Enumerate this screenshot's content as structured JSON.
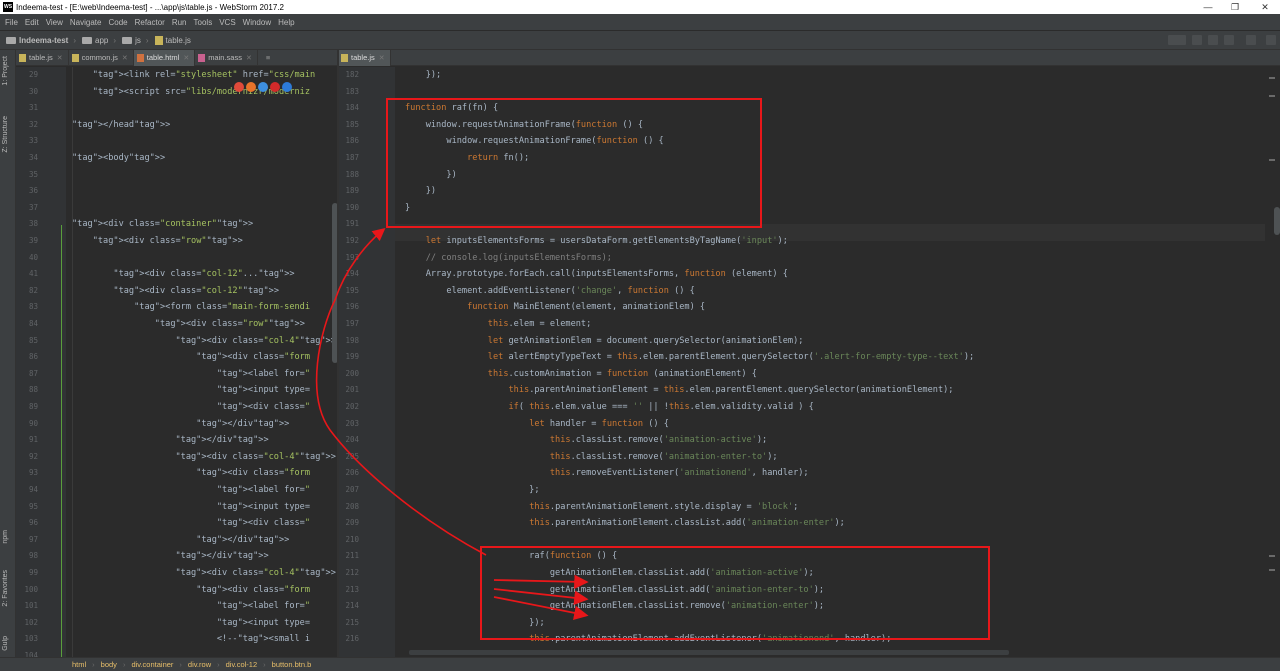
{
  "title": "Indeema-test - [E:\\web\\Indeema-test] - ...\\app\\js\\table.js - WebStorm 2017.2",
  "app_logo": "WS",
  "window_controls": [
    "—",
    "❐",
    "✕"
  ],
  "menu": [
    "File",
    "Edit",
    "View",
    "Navigate",
    "Code",
    "Refactor",
    "Run",
    "Tools",
    "VCS",
    "Window",
    "Help"
  ],
  "breadcrumbs": [
    "Indeema-test",
    "app",
    "js",
    "table.js"
  ],
  "left_tabs": [
    {
      "label": "table.js",
      "icon": "js-file-icon",
      "active": false
    },
    {
      "label": "common.js",
      "icon": "js-file-icon",
      "active": false
    },
    {
      "label": "table.html",
      "icon": "html-file-icon",
      "active": true
    },
    {
      "label": "main.sass",
      "icon": "sass-file-icon",
      "active": false
    }
  ],
  "left_tab_overflow": "≡",
  "right_tabs": [
    {
      "label": "table.js",
      "icon": "js-file-icon",
      "active": true
    }
  ],
  "toolwindows": {
    "project": "1: Project",
    "structure": "Z: Structure",
    "npm": "npm",
    "favorites": "2: Favorites",
    "gulp": "Gulp"
  },
  "browser_icons": [
    "chrome-icon",
    "firefox-icon",
    "safari-icon",
    "opera-icon",
    "ie-icon"
  ],
  "left_editor": {
    "lines": [
      {
        "n": "29",
        "text": "    <link rel=\"stylesheet\" href=\"css/main"
      },
      {
        "n": "30",
        "text": "    <script src=\"libs/modernizr/moderniz"
      },
      {
        "n": "31",
        "text": ""
      },
      {
        "n": "32",
        "text": "</head>"
      },
      {
        "n": "33",
        "text": ""
      },
      {
        "n": "34",
        "text": "<body>"
      },
      {
        "n": "35",
        "text": ""
      },
      {
        "n": "36",
        "text": ""
      },
      {
        "n": "37",
        "text": ""
      },
      {
        "n": "38",
        "text": "<div class=\"container\">"
      },
      {
        "n": "39",
        "text": "    <div class=\"row\">"
      },
      {
        "n": "40",
        "text": ""
      },
      {
        "n": "41",
        "text": "        <div class=\"col-12\"...>"
      },
      {
        "n": "82",
        "text": "        <div class=\"col-12\">"
      },
      {
        "n": "83",
        "text": "            <form class=\"main-form-sendi"
      },
      {
        "n": "84",
        "text": "                <div class=\"row\">"
      },
      {
        "n": "85",
        "text": "                    <div class=\"col-4\">"
      },
      {
        "n": "86",
        "text": "                        <div class=\"form"
      },
      {
        "n": "87",
        "text": "                            <label for=\""
      },
      {
        "n": "88",
        "text": "                            <input type="
      },
      {
        "n": "89",
        "text": "                            <div class=\""
      },
      {
        "n": "90",
        "text": "                        </div>"
      },
      {
        "n": "91",
        "text": "                    </div>"
      },
      {
        "n": "92",
        "text": "                    <div class=\"col-4\">"
      },
      {
        "n": "93",
        "text": "                        <div class=\"form"
      },
      {
        "n": "94",
        "text": "                            <label for=\""
      },
      {
        "n": "95",
        "text": "                            <input type="
      },
      {
        "n": "96",
        "text": "                            <div class=\""
      },
      {
        "n": "97",
        "text": "                        </div>"
      },
      {
        "n": "98",
        "text": "                    </div>"
      },
      {
        "n": "99",
        "text": "                    <div class=\"col-4\">"
      },
      {
        "n": "100",
        "text": "                        <div class=\"form"
      },
      {
        "n": "101",
        "text": "                            <label for=\""
      },
      {
        "n": "102",
        "text": "                            <input type="
      },
      {
        "n": "103",
        "text": "                            <!--<small i"
      },
      {
        "n": "104",
        "text": ""
      }
    ]
  },
  "right_editor": {
    "lines": [
      {
        "n": "182",
        "text": "    });"
      },
      {
        "n": "183",
        "text": ""
      },
      {
        "n": "184",
        "text": "function raf(fn) {"
      },
      {
        "n": "185",
        "text": "    window.requestAnimationFrame(function () {"
      },
      {
        "n": "186",
        "text": "        window.requestAnimationFrame(function () {"
      },
      {
        "n": "187",
        "text": "            return fn();"
      },
      {
        "n": "188",
        "text": "        })"
      },
      {
        "n": "189",
        "text": "    })"
      },
      {
        "n": "190",
        "text": "}"
      },
      {
        "n": "191",
        "text": ""
      },
      {
        "n": "192",
        "text": "    let inputsElementsForms = usersDataForm.getElementsByTagName('input');"
      },
      {
        "n": "193",
        "text": "    // console.log(inputsElementsForms);"
      },
      {
        "n": "194",
        "text": "    Array.prototype.forEach.call(inputsElementsForms, function (element) {"
      },
      {
        "n": "195",
        "text": "        element.addEventListener('change', function () {"
      },
      {
        "n": "196",
        "text": "            function MainElement(element, animationElem) {"
      },
      {
        "n": "197",
        "text": "                this.elem = element;"
      },
      {
        "n": "198",
        "text": "                let getAnimationElem = document.querySelector(animationElem);"
      },
      {
        "n": "199",
        "text": "                let alertEmptyTypeText = this.elem.parentElement.querySelector('.alert-for-empty-type--text');"
      },
      {
        "n": "200",
        "text": "                this.customAnimation = function (animationElement) {"
      },
      {
        "n": "201",
        "text": "                    this.parentAnimationElement = this.elem.parentElement.querySelector(animationElement);"
      },
      {
        "n": "202",
        "text": "                    if( this.elem.value === '' || !this.elem.validity.valid ) {"
      },
      {
        "n": "203",
        "text": "                        let handler = function () {"
      },
      {
        "n": "204",
        "text": "                            this.classList.remove('animation-active');"
      },
      {
        "n": "205",
        "text": "                            this.classList.remove('animation-enter-to');"
      },
      {
        "n": "206",
        "text": "                            this.removeEventListener('animationend', handler);"
      },
      {
        "n": "207",
        "text": "                        };"
      },
      {
        "n": "208",
        "text": "                        this.parentAnimationElement.style.display = 'block';"
      },
      {
        "n": "209",
        "text": "                        this.parentAnimationElement.classList.add('animation-enter');"
      },
      {
        "n": "210",
        "text": ""
      },
      {
        "n": "211",
        "text": "                        raf(function () {"
      },
      {
        "n": "212",
        "text": "                            getAnimationElem.classList.add('animation-active');"
      },
      {
        "n": "213",
        "text": "                            getAnimationElem.classList.add('animation-enter-to');"
      },
      {
        "n": "214",
        "text": "                            getAnimationElem.classList.remove('animation-enter');"
      },
      {
        "n": "215",
        "text": "                        });"
      },
      {
        "n": "216",
        "text": "                        this.parentAnimationElement.addEventListener('animationend', handler);"
      }
    ]
  },
  "status_breadcrumbs": [
    "html",
    "body",
    "div.container",
    "div.row",
    "div.col-12",
    "button.btn.b"
  ],
  "colors": {
    "annotation": "#e8171a",
    "editor_bg": "#2b2b2b",
    "chrome_bg": "#3c3f41"
  }
}
